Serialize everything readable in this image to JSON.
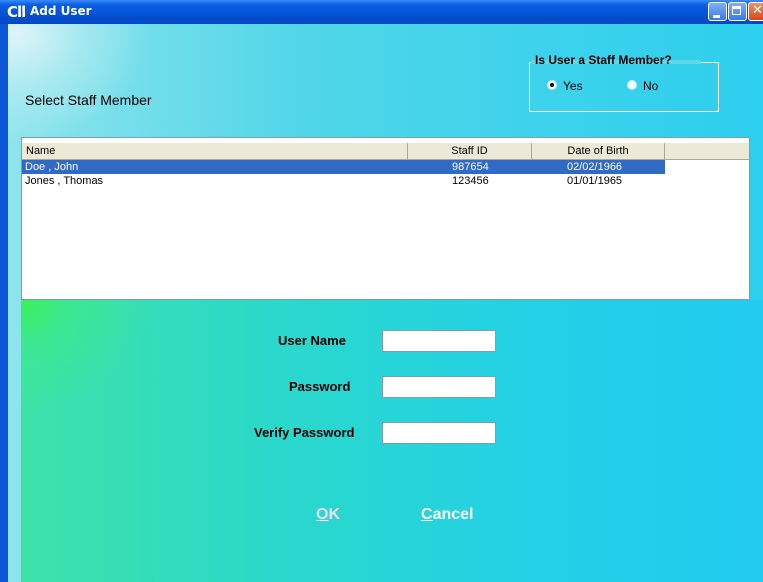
{
  "window": {
    "title": "Add User",
    "app_icon": "Cll",
    "controls": [
      "minimize-icon",
      "maximize-icon",
      "close-icon"
    ]
  },
  "staff_section": {
    "title": "Select Staff Member"
  },
  "staff_member_group": {
    "legend": "Is User a Staff Member?",
    "options": [
      {
        "label": "Yes",
        "checked": true
      },
      {
        "label": "No",
        "checked": false
      }
    ]
  },
  "staff_list": {
    "columns": [
      "Name",
      "Staff ID",
      "Date of Birth"
    ],
    "rows": [
      {
        "name": "Doe , John",
        "staff_id": "987654",
        "dob": "02/02/1966",
        "selected": true
      },
      {
        "name": "Jones , Thomas",
        "staff_id": "123456",
        "dob": "01/01/1965",
        "selected": false
      }
    ]
  },
  "form": {
    "user_name_label": "User Name",
    "user_name_value": "",
    "password_label": "Password",
    "password_value": "",
    "verify_password_label": "Verify Password",
    "verify_password_value": ""
  },
  "buttons": {
    "ok_first": "O",
    "ok_rest": "K",
    "cancel_first": "C",
    "cancel_rest": "ancel",
    "ok_enabled": false
  },
  "colors": {
    "title_bar": "#0551d6",
    "selection": "#316ac5",
    "background_cyan": "#2ccfee",
    "background_green": "#3cf05a"
  }
}
